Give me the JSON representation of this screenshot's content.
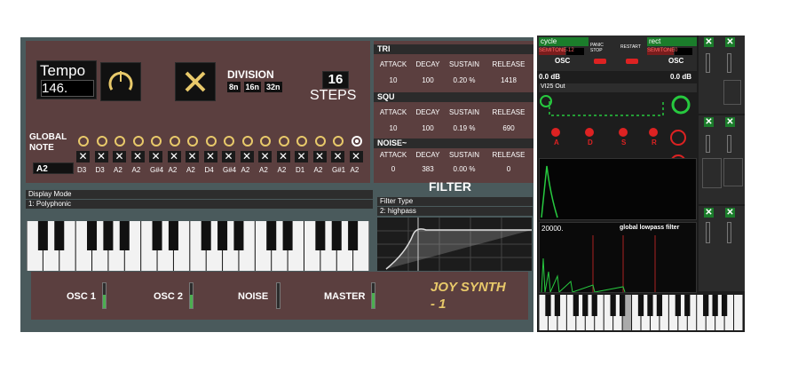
{
  "colors": {
    "accent": "#e8c96a",
    "panel": "#5b3f3f",
    "frame": "#4a5a5c",
    "green": "#27c93f",
    "red": "#d22222"
  },
  "sequencer": {
    "tempo_label": "Tempo",
    "tempo_value": "146.",
    "division_label": "DIVISION",
    "divisions": [
      "8n",
      "16n",
      "32n"
    ],
    "steps_value": "16",
    "steps_label": "STEPS",
    "global_note_label": "GLOBAL NOTE",
    "global_note_value": "A2",
    "notes": [
      "D3",
      "D3",
      "A2",
      "A2",
      "G#4",
      "A2",
      "A2",
      "D4",
      "G#4",
      "A2",
      "A2",
      "A2",
      "D1",
      "A2",
      "G#1",
      "A2"
    ]
  },
  "envelopes": {
    "columns": [
      "ATTACK",
      "DECAY",
      "SUSTAIN",
      "RELEASE"
    ],
    "tri": {
      "label": "TRI",
      "values": [
        "10",
        "100",
        "0.20 %",
        "1418"
      ]
    },
    "squ": {
      "label": "SQU",
      "values": [
        "10",
        "100",
        "0.19 %",
        "690"
      ]
    },
    "noise": {
      "label": "NOISE~",
      "values": [
        "0",
        "383",
        "0.00 %",
        "0"
      ]
    }
  },
  "filter": {
    "title": "FILTER",
    "type_label": "Filter Type",
    "type_value": "2: highpass"
  },
  "display": {
    "mode_label": "Display Mode",
    "mode_value": "1: Polyphonic"
  },
  "mixer": {
    "channels": [
      {
        "label": "OSC 1",
        "level": 0.55
      },
      {
        "label": "OSC 2",
        "level": 0.55
      },
      {
        "label": "NOISE",
        "level": 0.0
      },
      {
        "label": "MASTER",
        "level": 0.6
      }
    ],
    "brand": "JOY SYNTH - 1"
  },
  "right": {
    "osc_left": {
      "wave": "cycle",
      "semitone_label": "SEMITONE",
      "semitone_value": "-12",
      "label": "OSC",
      "db": "0.0 dB"
    },
    "osc_right": {
      "wave": "rect",
      "semitone_label": "SEMITONE",
      "semitone_value": "0",
      "label": "OSC",
      "db": "0.0 dB"
    },
    "panic_label": "PANIC STOP",
    "restart_label": "RESTART",
    "preset": "VI25 Out",
    "adsr": [
      "A",
      "D",
      "S",
      "R"
    ],
    "filter_freq": "20000.",
    "filter_label": "global lowpass filter"
  }
}
